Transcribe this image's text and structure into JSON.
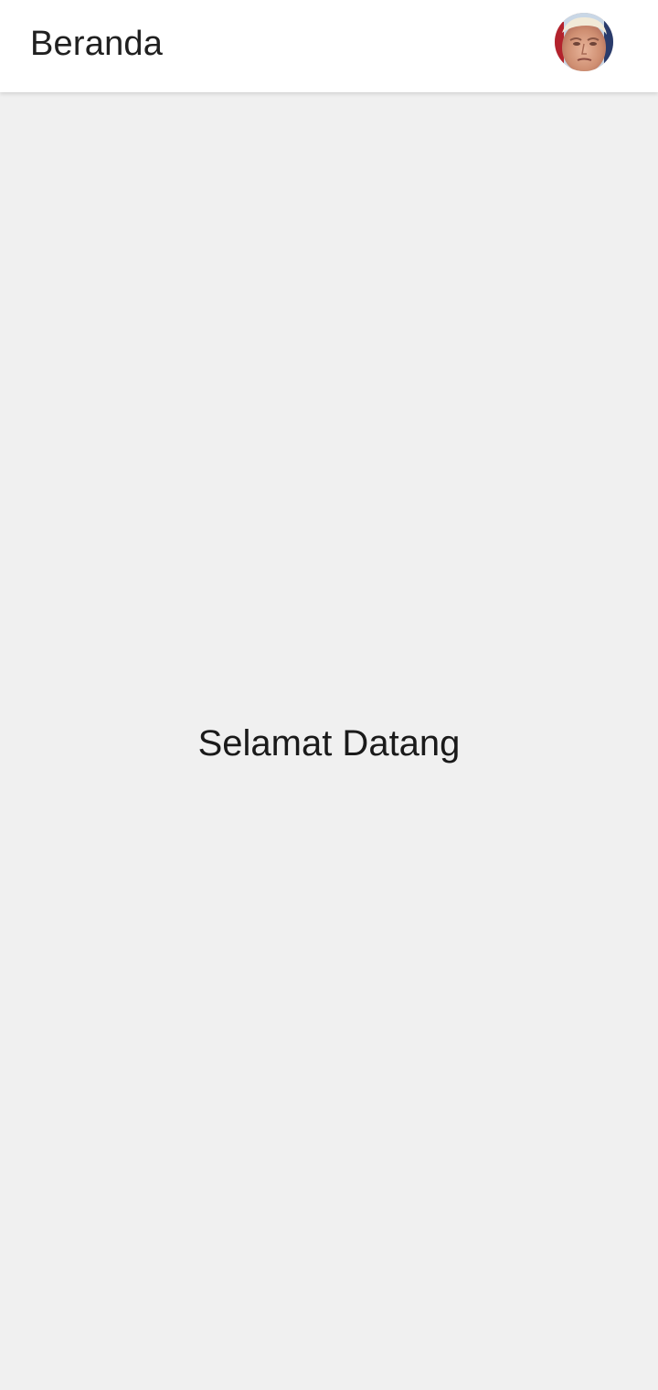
{
  "app_bar": {
    "title": "Beranda",
    "avatar_icon": "profile-avatar"
  },
  "main": {
    "welcome_text": "Selamat Datang"
  },
  "colors": {
    "app_bar_background": "#ffffff",
    "page_background": "#f0f0f0",
    "text": "#202020"
  }
}
